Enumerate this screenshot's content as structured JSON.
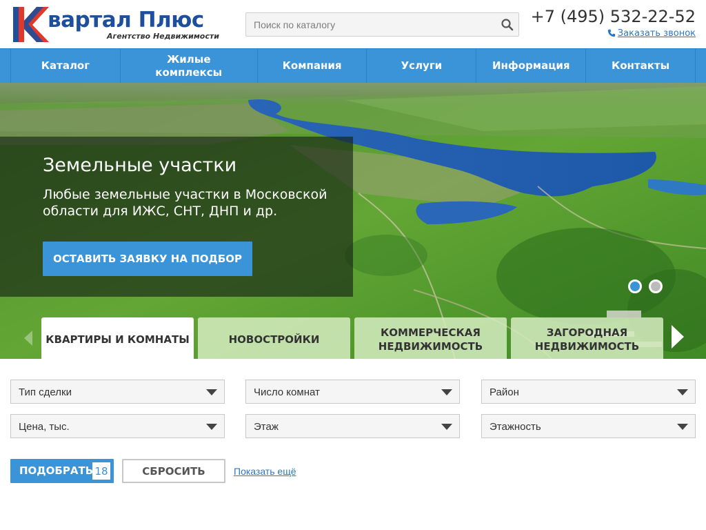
{
  "header": {
    "logo": {
      "title": "вартал Плюс",
      "subtitle": "Агентство Недвижимости"
    },
    "search": {
      "placeholder": "Поиск по каталогу"
    },
    "phone": "+7 (495) 532-22-52",
    "callback_label": "Заказать звонок"
  },
  "nav": {
    "items": [
      {
        "label": "Каталог"
      },
      {
        "label": "Жилые комплексы"
      },
      {
        "label": "Компания"
      },
      {
        "label": "Услуги"
      },
      {
        "label": "Информация"
      },
      {
        "label": "Контакты"
      }
    ]
  },
  "hero": {
    "title": "Земельные участки",
    "text": "Любые земельные участки в Московской области для ИЖС, СНТ, ДНП и др.",
    "cta_label": "ОСТАВИТЬ ЗАЯВКУ НА ПОДБОР",
    "slides_total": 2,
    "active_slide": 1
  },
  "tabs": [
    {
      "label": "КВАРТИРЫ И КОМНАТЫ",
      "active": true
    },
    {
      "label": "НОВОСТРОЙКИ",
      "active": false
    },
    {
      "label": "КОММЕРЧЕСКАЯ НЕДВИЖИМОСТЬ",
      "active": false
    },
    {
      "label": "ЗАГОРОДНАЯ НЕДВИЖИМОСТЬ",
      "active": false
    }
  ],
  "filters": {
    "deal_type": "Тип сделки",
    "rooms": "Число комнат",
    "district": "Район",
    "price": "Цена, тыс.",
    "floor": "Этаж",
    "floors_total": "Этажность"
  },
  "actions": {
    "apply_label": "ПОДОБРАТЬ",
    "apply_count": "18",
    "reset_label": "СБРОСИТЬ",
    "more_label": "Показать ещё"
  },
  "colors": {
    "brand_blue": "#3b93d8",
    "logo_red": "#e0392b",
    "logo_blue": "#1d4f9c",
    "link_blue": "#2b78c2"
  }
}
